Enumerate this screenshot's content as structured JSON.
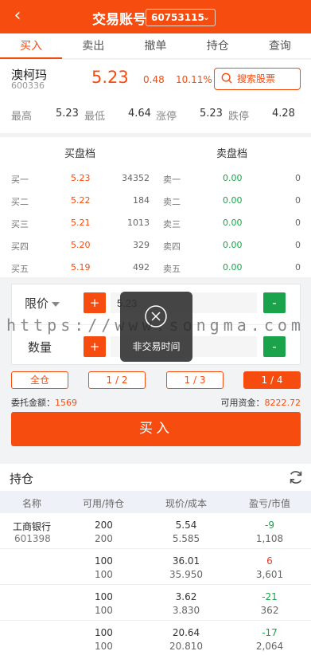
{
  "header": {
    "title": "交易账号",
    "account": "60753115",
    "back_icon": "back-chevron-icon"
  },
  "tabs": [
    {
      "label": "买入",
      "active": true
    },
    {
      "label": "卖出",
      "active": false
    },
    {
      "label": "撤单",
      "active": false
    },
    {
      "label": "持仓",
      "active": false
    },
    {
      "label": "查询",
      "active": false
    }
  ],
  "stock": {
    "name": "澳柯玛",
    "code": "600336",
    "price": "5.23",
    "change": "0.48",
    "change_pct": "10.11%",
    "search_label": "搜索股票",
    "stats": {
      "high_label": "最高",
      "high": "5.23",
      "low_label": "最低",
      "low": "4.64",
      "limit_up_label": "涨停",
      "limit_up": "5.23",
      "limit_down_label": "跌停",
      "limit_down": "4.28"
    }
  },
  "order_book": {
    "buy_title": "买盘档",
    "sell_title": "卖盘档",
    "rows": [
      {
        "buy_label": "买一",
        "buy_price": "5.23",
        "buy_vol": "34352",
        "sell_label": "卖一",
        "sell_price": "0.00",
        "sell_vol": "0"
      },
      {
        "buy_label": "买二",
        "buy_price": "5.22",
        "buy_vol": "184",
        "sell_label": "卖二",
        "sell_price": "0.00",
        "sell_vol": "0"
      },
      {
        "buy_label": "买三",
        "buy_price": "5.21",
        "buy_vol": "1013",
        "sell_label": "卖三",
        "sell_price": "0.00",
        "sell_vol": "0"
      },
      {
        "buy_label": "买四",
        "buy_price": "5.20",
        "buy_vol": "329",
        "sell_label": "卖四",
        "sell_price": "0.00",
        "sell_vol": "0"
      },
      {
        "buy_label": "买五",
        "buy_price": "5.19",
        "buy_vol": "492",
        "sell_label": "卖五",
        "sell_price": "0.00",
        "sell_vol": "0"
      }
    ]
  },
  "form": {
    "price_type": "限价",
    "price_value": "5.23",
    "qty_label": "数量",
    "qty_value": "",
    "plus": "+",
    "minus": "-"
  },
  "toast": {
    "text": "非交易时间",
    "icon": "close-circle-icon"
  },
  "watermark": "https://www.songma.com",
  "ratios": [
    {
      "label": "全仓",
      "active": false
    },
    {
      "label": "1 / 2",
      "active": false
    },
    {
      "label": "1 / 3",
      "active": false
    },
    {
      "label": "1 / 4",
      "active": true
    }
  ],
  "amounts": {
    "entrust_label": "委托金额：",
    "entrust_value": "1569",
    "avail_label": "可用资金：",
    "avail_value": "8222.72"
  },
  "buy_button": "买入",
  "holdings": {
    "title": "持仓",
    "refresh_icon": "refresh-icon",
    "columns": [
      "名称",
      "可用/持仓",
      "现价/成本",
      "盈亏/市值"
    ],
    "rows": [
      {
        "name": "工商银行",
        "code": "601398",
        "available": "200",
        "held": "200",
        "price": "5.54",
        "cost": "5.585",
        "pnl": "-9",
        "value": "1,108",
        "trend": "down"
      },
      {
        "name": "",
        "code": "",
        "available": "100",
        "held": "100",
        "price": "36.01",
        "cost": "35.950",
        "pnl": "6",
        "value": "3,601",
        "trend": "up"
      },
      {
        "name": "",
        "code": "",
        "available": "100",
        "held": "100",
        "price": "3.62",
        "cost": "3.830",
        "pnl": "-21",
        "value": "362",
        "trend": "down"
      },
      {
        "name": "",
        "code": "",
        "available": "100",
        "held": "100",
        "price": "20.64",
        "cost": "20.810",
        "pnl": "-17",
        "value": "2,064",
        "trend": "down"
      }
    ]
  }
}
